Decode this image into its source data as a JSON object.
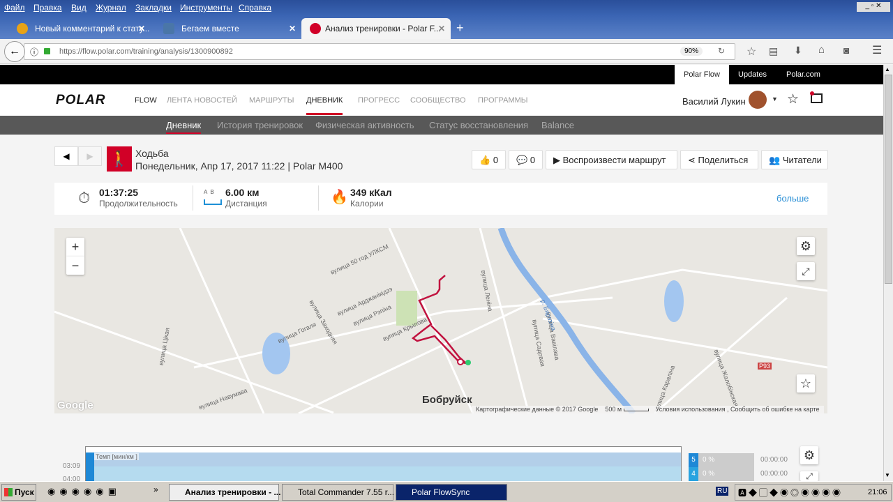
{
  "menu": [
    "Файл",
    "Правка",
    "Вид",
    "Журнал",
    "Закладки",
    "Инструменты",
    "Справка"
  ],
  "tabs": [
    {
      "label": "Новый комментарий к стату..."
    },
    {
      "label": "Бегаем вместе"
    },
    {
      "label": "Анализ тренировки - Polar F..."
    }
  ],
  "url": "https://flow.polar.com/training/analysis/1300900892",
  "zoom": "90%",
  "top_links": [
    "Polar Flow",
    "Updates",
    "Polar.com"
  ],
  "logo": "POLAR",
  "flow": "FLOW",
  "nav": [
    "ЛЕНТА НОВОСТЕЙ",
    "МАРШРУТЫ",
    "ДНЕВНИК",
    "ПРОГРЕСС",
    "СООБЩЕСТВО",
    "ПРОГРАММЫ"
  ],
  "user": "Василий Лукин",
  "subnav": [
    "Дневник",
    "История тренировок",
    "Физическая активность",
    "Статус восстановления",
    "Balance"
  ],
  "activity": {
    "sport": "Ходьба",
    "date": "Понедельник, Апр 17, 2017 11:22 | Polar M400"
  },
  "actions": {
    "likes": "0",
    "comments": "0",
    "replay": "Воспроизвести маршрут",
    "share": "Поделиться",
    "readers": "Читатели"
  },
  "summary": {
    "duration": "01:37:25",
    "duration_label": "Продолжительность",
    "distance": "6.00 км",
    "distance_label": "Дистанция",
    "ab": "A  B",
    "calories": "349 кКал",
    "calories_label": "Калории",
    "more": "больше"
  },
  "map": {
    "city": "Бобруйск",
    "streets": [
      "вулица 50 год УЛКСМ",
      "вулица Арджанікідзэ",
      "вулица Рэпіна",
      "вулица Заходняя",
      "вулица Гогаля",
      "вулица Крылова",
      "вулица Леніна",
      "вулица Садовая",
      "вулица Вавілава",
      "р. Бярэзіна",
      "вулица Цікая",
      "вулица Навумава",
      "вулица Жалобінская",
      "вулица Караліна",
      "Р93"
    ],
    "google": "Google",
    "credits": "Картографические данные © 2017 Google",
    "scale": "500 м",
    "terms": "Условия использования",
    "report": "Сообщить об ошибке на карте"
  },
  "chart": {
    "label": "Темп [мин/км ]",
    "y": [
      "03:09",
      "04:00"
    ],
    "zones": [
      {
        "n": "5",
        "pct": "0 %",
        "t": "00:00:00"
      },
      {
        "n": "4",
        "pct": "0 %",
        "t": "00:00:00"
      }
    ]
  },
  "taskbar": {
    "start": "Пуск",
    "items": [
      "Анализ тренировки - ...",
      "Total Commander 7.55 r...",
      "Polar FlowSync"
    ],
    "lang": "RU",
    "clock": "21:06"
  }
}
